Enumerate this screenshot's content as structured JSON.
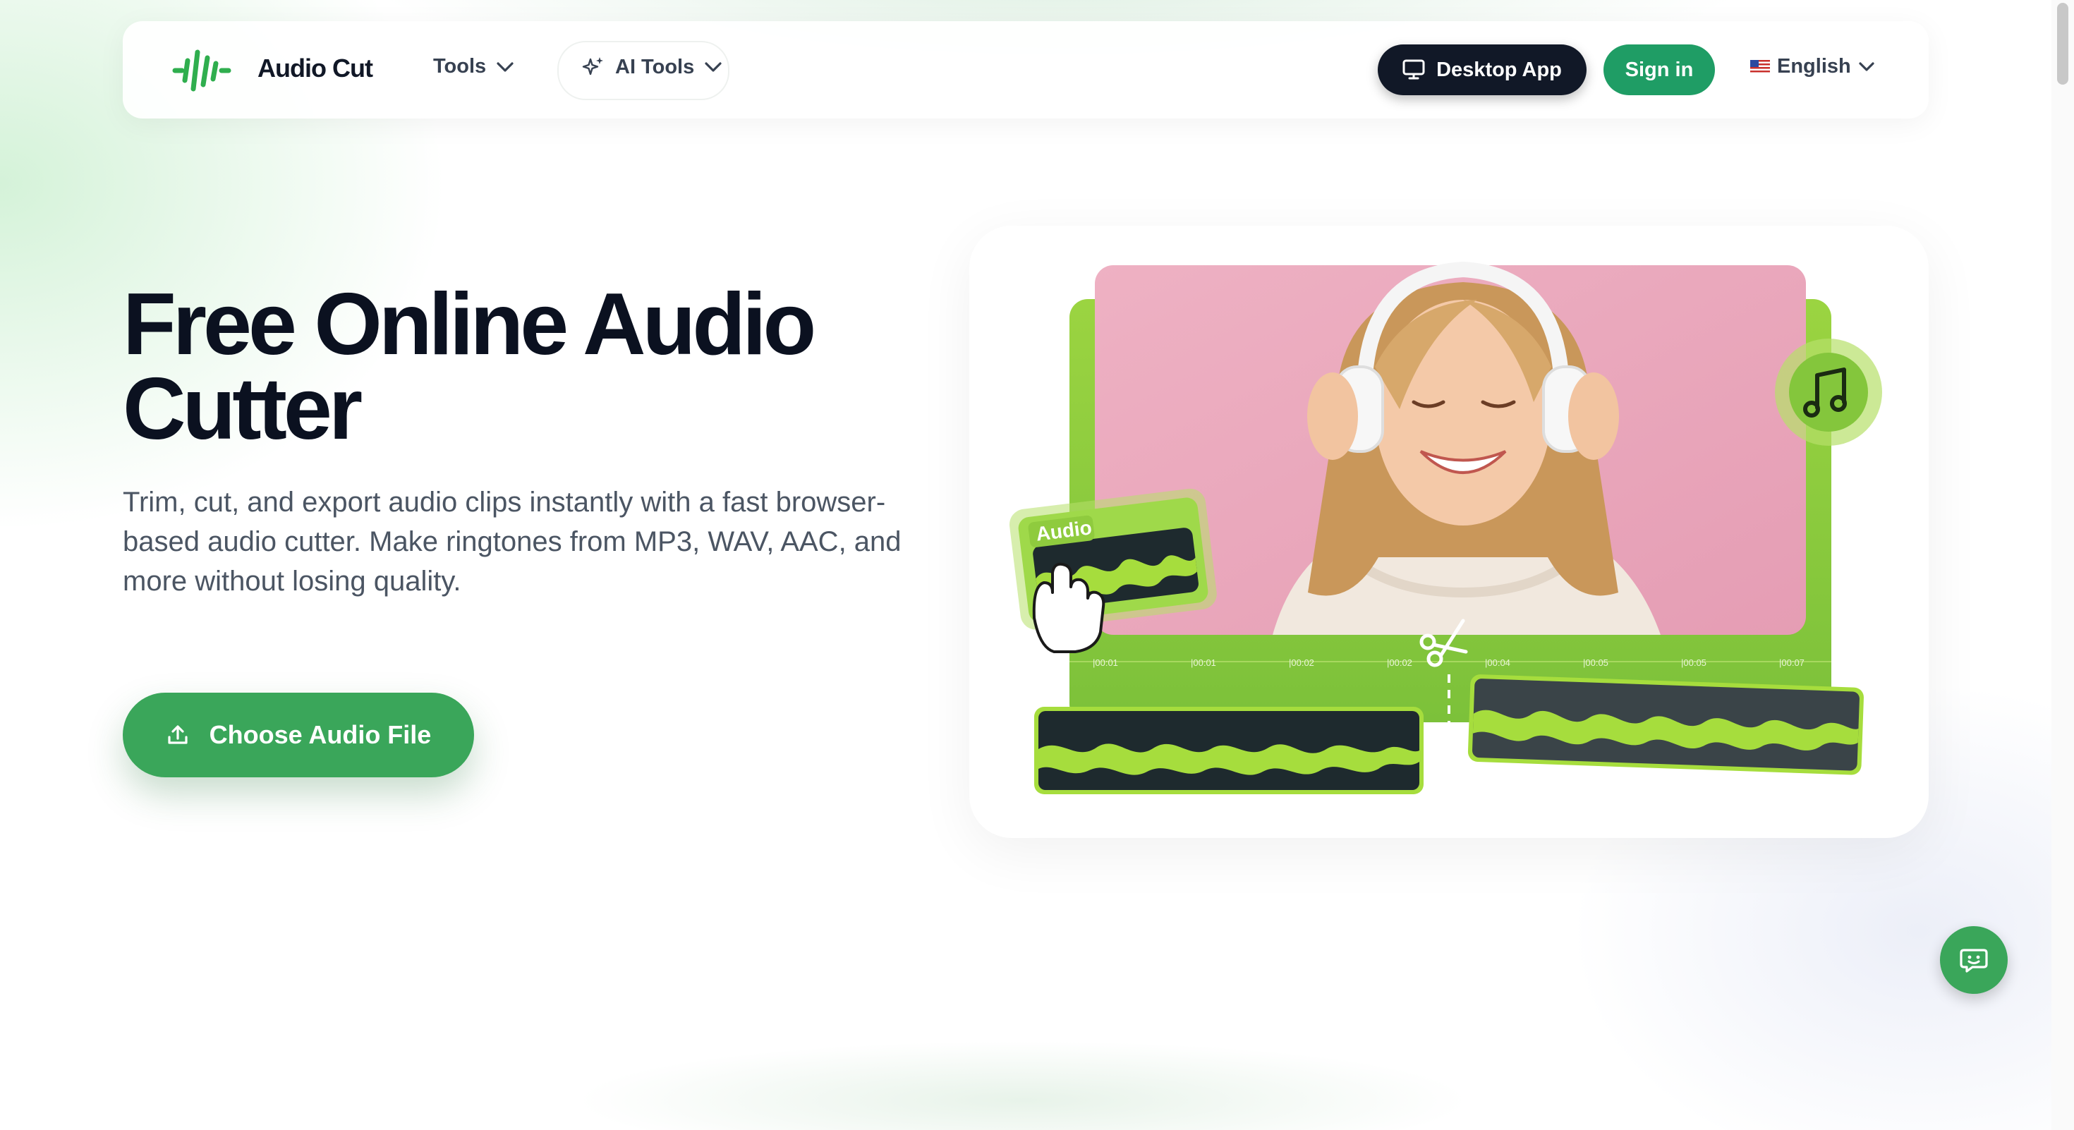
{
  "nav": {
    "brand": "Audio Cut",
    "tools_label": "Tools",
    "ai_tools_label": "AI Tools",
    "desktop_app_label": "Desktop App",
    "sign_in_label": "Sign in",
    "language_label": "English",
    "language_flag": "US flag"
  },
  "hero": {
    "title": "Free Online Audio Cutter",
    "subtitle": "Trim, cut, and export audio clips instantly with a fast browser-based audio cutter. Make ringtones from MP3, WAV, AAC, and more without losing quality.",
    "cta_label": "Choose Audio File",
    "illustration": {
      "audio_tag": "Audio",
      "timeline_ticks": [
        "|00:01",
        "|00:01",
        "|00:02",
        "|00:02",
        "|00:04",
        "|00:05",
        "|00:05",
        "|00:07"
      ]
    }
  },
  "icons": {
    "logo": "waveform-logo-icon",
    "tools_chevron": "chevron-down-icon",
    "ai_sparkle": "sparkle-icon",
    "desktop": "monitor-icon",
    "language_chevron": "chevron-down-icon",
    "upload": "upload-icon",
    "chat": "chat-icon",
    "music": "music-note-icon",
    "scissors": "scissors-icon",
    "hand": "hand-cursor-icon"
  },
  "colors": {
    "brand_green": "#3aa65a",
    "sign_in_green": "#1f9d65",
    "dark": "#111827",
    "lime": "#9bd441",
    "pink": "#e8a8bc"
  }
}
